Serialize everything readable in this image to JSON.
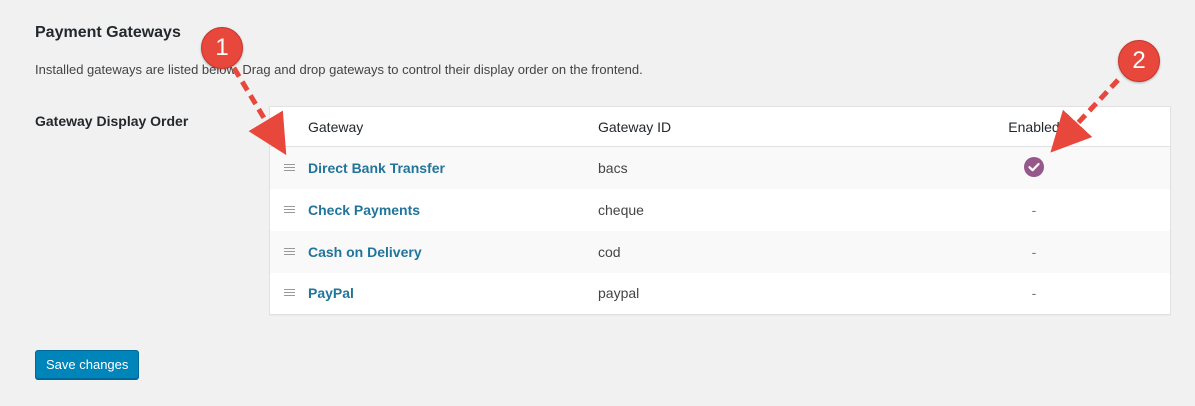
{
  "section": {
    "title": "Payment Gateways",
    "description": "Installed gateways are listed below. Drag and drop gateways to control their display order on the frontend."
  },
  "field": {
    "label": "Gateway Display Order"
  },
  "table": {
    "headers": {
      "gateway": "Gateway",
      "gateway_id": "Gateway ID",
      "enabled": "Enabled"
    },
    "rows": [
      {
        "name": "Direct Bank Transfer",
        "id": "bacs",
        "enabled": true,
        "enabled_text": ""
      },
      {
        "name": "Check Payments",
        "id": "cheque",
        "enabled": false,
        "enabled_text": "-"
      },
      {
        "name": "Cash on Delivery",
        "id": "cod",
        "enabled": false,
        "enabled_text": "-"
      },
      {
        "name": "PayPal",
        "id": "paypal",
        "enabled": false,
        "enabled_text": "-"
      }
    ]
  },
  "actions": {
    "save_label": "Save changes"
  },
  "annotations": [
    {
      "number": "1"
    },
    {
      "number": "2"
    }
  ],
  "colors": {
    "link": "#21759b",
    "enabled_check": "#96588a",
    "primary_button": "#0085ba",
    "annotation": "#e8473c"
  },
  "icons": {
    "row_handle": "drag-handle-icon",
    "enabled": "checkmark-circle-icon"
  }
}
